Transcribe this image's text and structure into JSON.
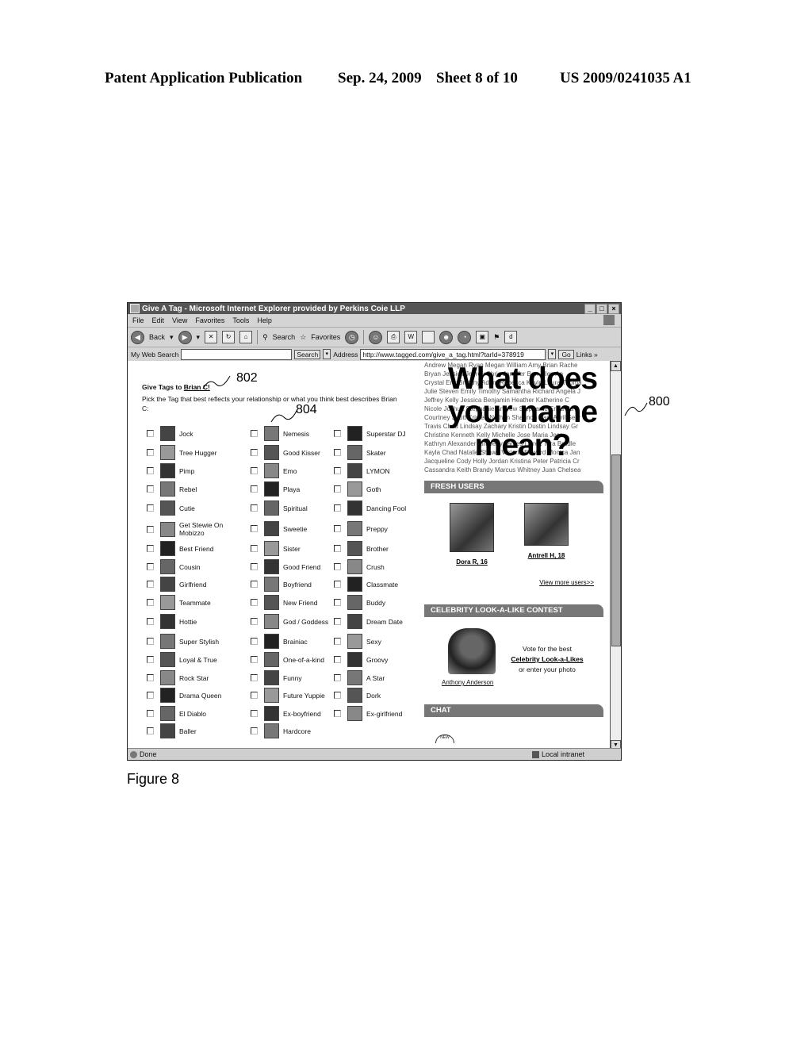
{
  "patent": {
    "publication": "Patent Application Publication",
    "date": "Sep. 24, 2009",
    "sheet": "Sheet 8 of 10",
    "number": "US 2009/0241035 A1"
  },
  "figure_label": "Figure 8",
  "callouts": {
    "window": "800",
    "title": "802",
    "tag": "804"
  },
  "browser": {
    "title": "Give A Tag - Microsoft Internet Explorer provided by Perkins Coie LLP",
    "window_buttons": [
      "_",
      "□",
      "×"
    ],
    "menu": [
      "File",
      "Edit",
      "View",
      "Favorites",
      "Tools",
      "Help"
    ],
    "toolbar": {
      "back": "Back",
      "search": "Search",
      "favorites": "Favorites"
    },
    "address_row": {
      "my_web_search": "My Web Search",
      "search_button": "Search",
      "address_label": "Address",
      "url": "http://www.tagged.com/give_a_tag.html?tarId=378919",
      "go": "Go",
      "links": "Links »"
    },
    "status": {
      "text": "Done",
      "zone": "Local intranet"
    }
  },
  "page": {
    "give_title_prefix": "Give Tags to",
    "give_title_name": "Brian C!",
    "description": "Pick the Tag that best reflects your relationship or what you think best describes Brian C:",
    "tags": [
      [
        "Jock",
        "Nemesis",
        "Superstar DJ"
      ],
      [
        "Tree Hugger",
        "Good Kisser",
        "Skater"
      ],
      [
        "Pimp",
        "Emo",
        "LYMON"
      ],
      [
        "Rebel",
        "Playa",
        "Goth"
      ],
      [
        "Cutie",
        "Spiritual",
        "Dancing Fool"
      ],
      [
        "Get Stewie On Mobizzo",
        "Sweetie",
        "Preppy"
      ],
      [
        "Best Friend",
        "Sister",
        "Brother"
      ],
      [
        "Cousin",
        "Good Friend",
        "Crush"
      ],
      [
        "Girlfriend",
        "Boyfriend",
        "Classmate"
      ],
      [
        "Teammate",
        "New Friend",
        "Buddy"
      ],
      [
        "Hottie",
        "God / Goddess",
        "Dream Date"
      ],
      [
        "Super Stylish",
        "Brainiac",
        "Sexy"
      ],
      [
        "Loyal & True",
        "One-of-a-kind",
        "Groovy"
      ],
      [
        "Rock Star",
        "Funny",
        "A Star"
      ],
      [
        "Drama Queen",
        "Future Yuppie",
        "Dork"
      ],
      [
        "El Diablo",
        "Ex-boyfriend",
        "Ex-girlfriend"
      ],
      [
        "Baller",
        "Hardcore",
        null
      ]
    ],
    "names_banner": {
      "headline": "What does your name mean?",
      "names_lines": [
        "Andrew Megan Ryan Megan William Amy Brian Rache",
        "Bryan Jessica Jeffrey Chris Jennifer Ben Allen An",
        "Crystal Eric Brittany Adam Rebecca Kevin Laura Thoma",
        "Julie Steven Emily Timothy Samantha Richard Angela J",
        "Jeffrey Kelly Jessica Benjamin Heather Katherine C",
        "Nicole Joshua Stephanie Andrew Stephanie Erica Pa",
        "Courtney Scott Kristen Nathan Shannon Paul April Sear",
        "Travis Chad Lindsay Zachary Kristin Dustin Lindsay Gr",
        "Christine Kenneth Kelly Michelle Jose Maria Jess",
        "Kathryn Alexander Kimberly James Derek Tara Bradle",
        "Kayla Chad Natalie Shawn Victoria Edward Monica Jan",
        "Jacqueline Cody Holly Jordan Kristina Peter Patricia Cr",
        "Cassandra Keith Brandy Marcus Whitney Juan Chelsea"
      ]
    },
    "fresh_users": {
      "heading": "FRESH USERS",
      "users": [
        {
          "name": "Dora R, 16"
        },
        {
          "name": "Antrell H, 18"
        }
      ],
      "view_more": "View more users>>"
    },
    "celebrity": {
      "heading": "CELEBRITY LOOK-A-LIKE CONTEST",
      "celebrity_name": "Anthony Anderson",
      "vote_line1": "Vote for the best",
      "vote_link": "Celebrity Look-a-Likes",
      "vote_line2": "or enter your photo"
    },
    "chat": {
      "heading": "CHAT",
      "badge": "NEW"
    }
  }
}
